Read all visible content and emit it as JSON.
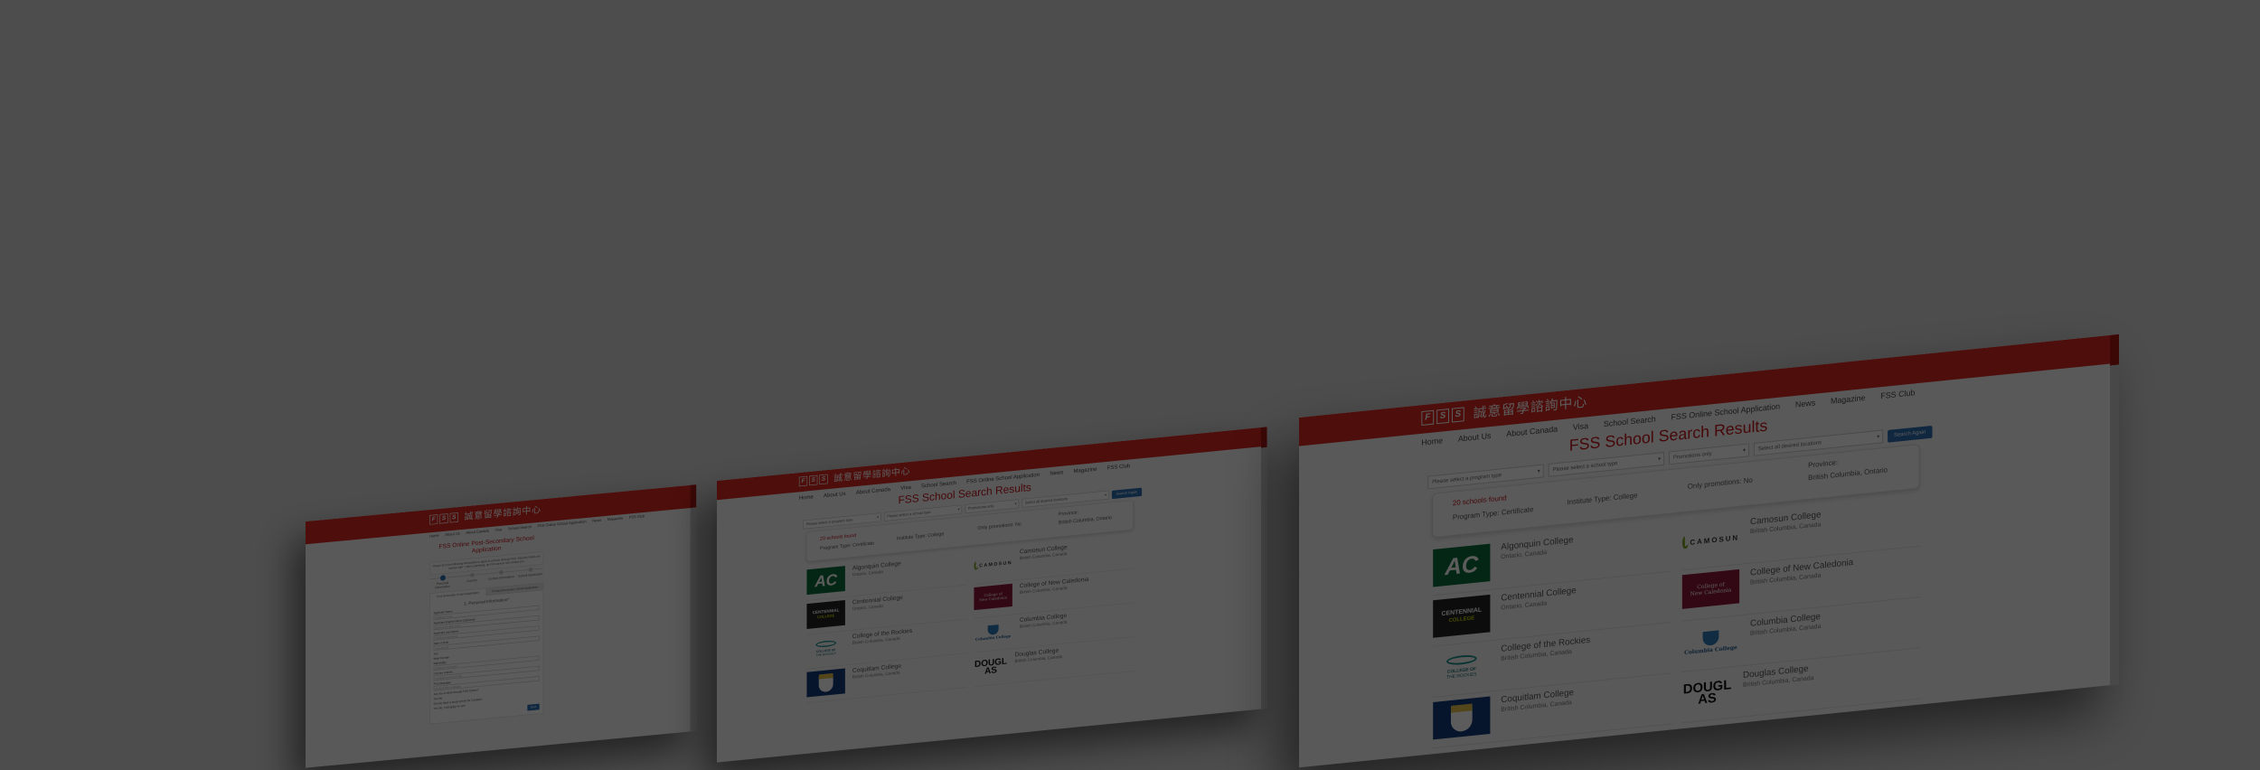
{
  "site": {
    "logo_marks": [
      "F",
      "S",
      "S"
    ],
    "logo_chinese": "誠意留學諮詢中心",
    "nav": [
      "Home",
      "About Us",
      "About Canada",
      "Visa",
      "School Search",
      "FSS Online School Application",
      "News",
      "Magazine",
      "FSS Club"
    ]
  },
  "search": {
    "title": "FSS School Search Results",
    "filters": {
      "program_type": "Please select a program type",
      "school_type": "Please select a school type",
      "promotions": "Promotions only",
      "locations": "Select all desired locations",
      "search_again": "Search Again"
    },
    "summary": {
      "count": "20 schools found",
      "program_type": "Program Type: Certificate",
      "institute_type": "Institute Type: College",
      "promotions": "Only promotions: No",
      "province_label": "Province:",
      "province_value": "British Columbia, Ontario"
    },
    "schools": [
      {
        "name": "Algonquin College",
        "location": "Ontario, Canada",
        "logo": "AC"
      },
      {
        "name": "Camosun College",
        "location": "British Columbia, Canada",
        "logo": "CAMOSUN"
      },
      {
        "name": "Centennial College",
        "location": "Ontario, Canada",
        "logo": "CENTENNIAL|COLLEGE"
      },
      {
        "name": "College of New Caledonia",
        "location": "British Columbia, Canada",
        "logo": "College of|New Caledonia"
      },
      {
        "name": "College of the Rockies",
        "location": "British Columbia, Canada",
        "logo": "COLLEGE OF|THE ROCKIES"
      },
      {
        "name": "Columbia College",
        "location": "British Columbia, Canada",
        "logo": "Columbia College"
      },
      {
        "name": "Coquitlam College",
        "location": "British Columbia, Canada",
        "logo": ""
      },
      {
        "name": "Douglas College",
        "location": "British Columbia, Canada",
        "logo": "DOUGLAS"
      }
    ]
  },
  "application": {
    "title": "FSS Online Post-Secondary School Application",
    "intro": "Please fill in the following information to apply to schools through FSS. Required fields are marked with *. After submitting, an FSS advisor will contact you.",
    "steps": [
      "Personal Information",
      "Country",
      "Contact Information",
      "Submit Application"
    ],
    "tabs": [
      "Post-Secondary School Application",
      "Primary/Secondary School Application"
    ],
    "section": "1. Personal Information*",
    "fields": [
      {
        "label": "Applicant Name",
        "placeholder": "Applicant Name"
      },
      {
        "label": "Applicant English Name (Optional)",
        "placeholder": "Applicant English Name"
      },
      {
        "label": "Applicant Last Name",
        "placeholder": "Applicant Last Name"
      },
      {
        "label": "Date of Birth",
        "placeholder": "yyyy-mm-dd"
      }
    ],
    "sex_label": "Sex",
    "sex_value": "Male  Female",
    "fields2": [
      {
        "label": "Nationality",
        "placeholder": "Applicant nationality"
      },
      {
        "label": "Country of Birth",
        "placeholder": "Applicant country of birth"
      },
      {
        "label": "First language",
        "placeholder": "Applicant first language"
      }
    ],
    "q1": "Are you a client through FSS Center?",
    "q1_value": "Yes  No",
    "q2": "Do you have a study permit for Canada?",
    "q2_value": "Yes  No, I will apply for one",
    "next": "Next"
  },
  "colors": {
    "brand_red": "#d8261f",
    "title_red": "#c4161c",
    "button_blue": "#2a6db0"
  }
}
